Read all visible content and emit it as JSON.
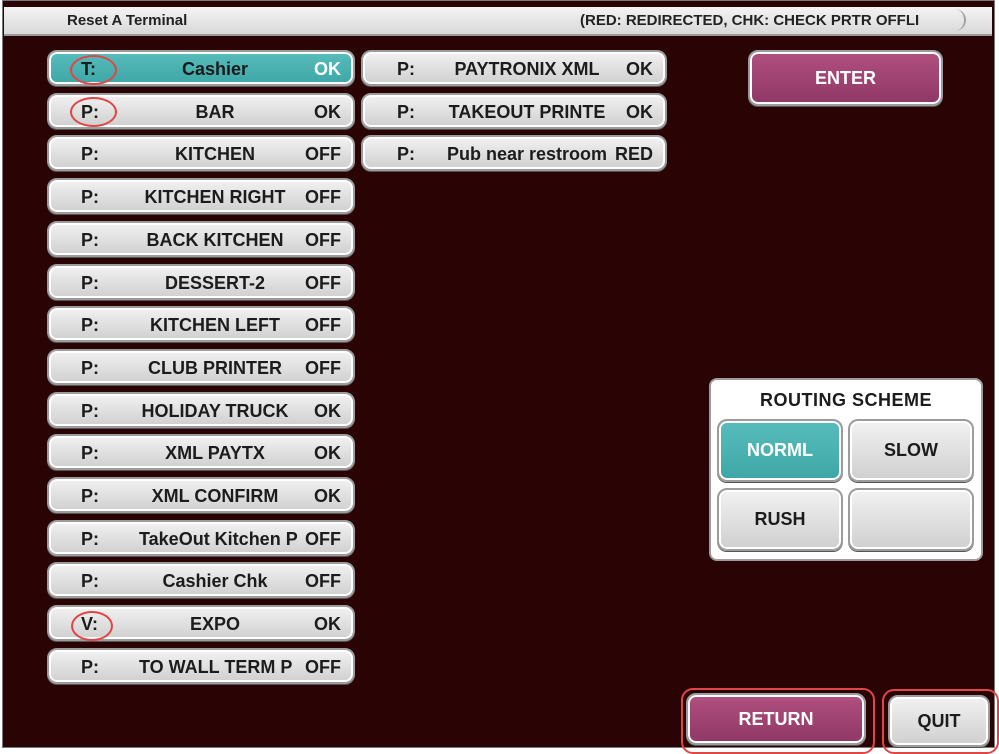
{
  "window": {
    "title": "Reset A Terminal",
    "legend": "(RED: REDIRECTED,  CHK: CHECK PRTR OFFLI"
  },
  "devices_left": [
    {
      "type": "T:",
      "name": "Cashier",
      "status": "OK",
      "selected": true
    },
    {
      "type": "P:",
      "name": "BAR",
      "status": "OK"
    },
    {
      "type": "P:",
      "name": "KITCHEN",
      "status": "OFF"
    },
    {
      "type": "P:",
      "name": "KITCHEN RIGHT",
      "status": "OFF"
    },
    {
      "type": "P:",
      "name": "BACK KITCHEN",
      "status": "OFF"
    },
    {
      "type": "P:",
      "name": "DESSERT-2",
      "status": "OFF"
    },
    {
      "type": "P:",
      "name": "KITCHEN LEFT",
      "status": "OFF"
    },
    {
      "type": "P:",
      "name": "CLUB PRINTER",
      "status": "OFF"
    },
    {
      "type": "P:",
      "name": "HOLIDAY TRUCK",
      "status": "OK"
    },
    {
      "type": "P:",
      "name": "XML PAYTX",
      "status": "OK"
    },
    {
      "type": "P:",
      "name": "XML CONFIRM",
      "status": "OK"
    },
    {
      "type": "P:",
      "name": "TakeOut Kitchen P",
      "status": "OFF"
    },
    {
      "type": "P:",
      "name": "Cashier Chk",
      "status": "OFF"
    },
    {
      "type": "V:",
      "name": "EXPO",
      "status": "OK"
    },
    {
      "type": "P:",
      "name": "TO WALL TERM P",
      "status": "OFF"
    }
  ],
  "devices_right": [
    {
      "type": "P:",
      "name": "PAYTRONIX XML",
      "status": "OK"
    },
    {
      "type": "P:",
      "name": "TAKEOUT PRINTE",
      "status": "OK"
    },
    {
      "type": "P:",
      "name": "Pub near restroom",
      "status": "RED"
    }
  ],
  "actions": {
    "enter": "ENTER",
    "return": "RETURN",
    "quit": "QUIT"
  },
  "routing": {
    "title": "ROUTING  SCHEME",
    "options": [
      "NORML",
      "SLOW",
      "RUSH",
      ""
    ],
    "selected": "NORML"
  },
  "colors": {
    "background": "#2a0405",
    "selected": "#48b0b0",
    "action": "#9e4372",
    "highlight": "#e24545"
  }
}
